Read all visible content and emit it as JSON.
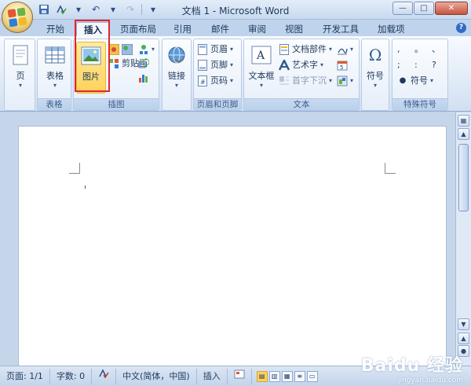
{
  "title_bar": {
    "title": "文档 1 - Microsoft Word",
    "qat_icons": [
      "save-icon",
      "spelling-icon",
      "undo-icon",
      "redo-icon",
      "customize-icon"
    ],
    "window_controls": [
      "minimize-icon",
      "maximize-icon",
      "close-icon"
    ]
  },
  "tabs": [
    "开始",
    "插入",
    "页面布局",
    "引用",
    "邮件",
    "审阅",
    "视图",
    "开发工具",
    "加载项"
  ],
  "active_tab": "插入",
  "help_label": "?",
  "ribbon": {
    "groups": {
      "pages": {
        "label": "",
        "button": "页"
      },
      "tables": {
        "label": "表格",
        "button": "表格"
      },
      "illustrations": {
        "label": "插图",
        "picture": "图片",
        "clipart": "剪贴画"
      },
      "links": {
        "label": "",
        "button": "链接"
      },
      "header_footer": {
        "label": "页眉和页脚",
        "header": "页眉",
        "footer": "页脚",
        "page_number": "页码"
      },
      "text": {
        "label": "文本",
        "textbox": "文本框",
        "quickparts": "文档部件",
        "wordart": "艺术字",
        "dropcap": "首字下沉"
      },
      "symbols": {
        "label": "",
        "button": "符号"
      },
      "special": {
        "label": "特殊符号",
        "chars": [
          ",",
          "。",
          "、",
          ";",
          ":",
          "?"
        ],
        "button": "符号"
      }
    }
  },
  "status_bar": {
    "page": "页面: 1/1",
    "words": "字数: 0",
    "language": "中文(简体，中国)",
    "mode": "插入"
  },
  "watermark": {
    "line1": "Baidu 经验",
    "line2": "jingyan.baidu.com"
  },
  "colors": {
    "highlight": "#e0262e",
    "selected_button": "#ffd15c",
    "ribbon_bg": "#dde8f6"
  }
}
